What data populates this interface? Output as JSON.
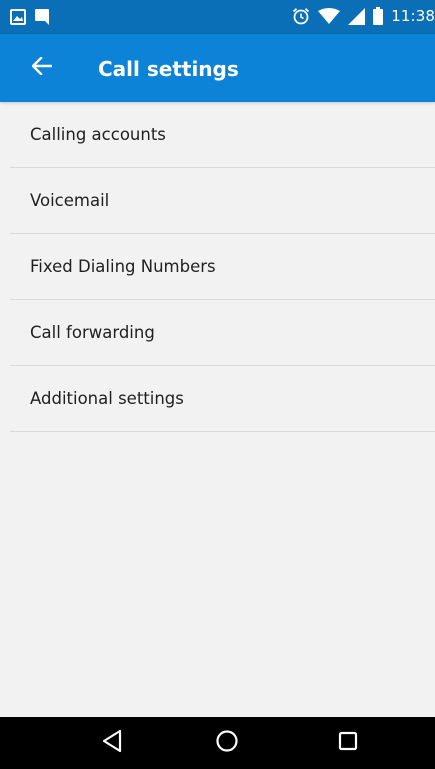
{
  "status_bar": {
    "time": "11:38",
    "left_icons": [
      "gallery-notification-icon",
      "message-notification-icon"
    ],
    "right_icons": [
      "alarm-icon",
      "wifi-icon",
      "cell-signal-icon",
      "battery-icon"
    ]
  },
  "app_bar": {
    "title": "Call settings",
    "back_icon": "arrow-left-icon"
  },
  "settings": {
    "items": [
      {
        "label": "Calling accounts"
      },
      {
        "label": "Voicemail"
      },
      {
        "label": "Fixed Dialing Numbers"
      },
      {
        "label": "Call forwarding"
      },
      {
        "label": "Additional settings"
      }
    ]
  },
  "nav_bar": {
    "buttons": [
      "back-triangle-icon",
      "home-circle-icon",
      "recents-square-icon"
    ]
  },
  "colors": {
    "status_bar_bg": "#0a6fb6",
    "app_bar_bg": "#0c83d6",
    "page_bg": "#f2f2f2",
    "text_primary": "#212121",
    "divider": "#d9d9d9",
    "nav_bar_bg": "#000000"
  }
}
